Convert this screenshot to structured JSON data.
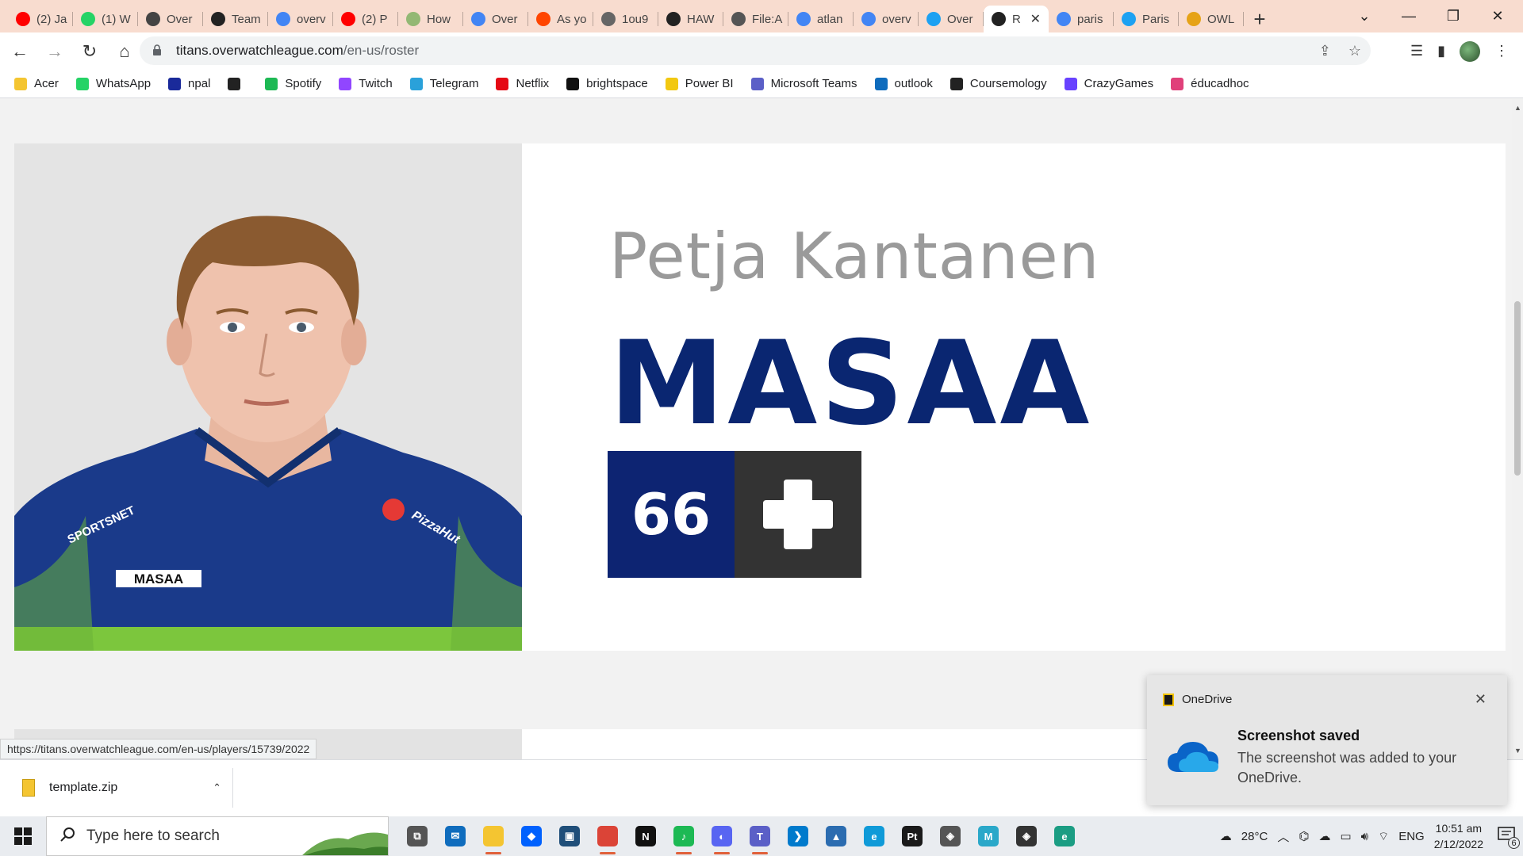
{
  "browser": {
    "tabs": [
      {
        "title": "(2) Ja",
        "favicon": "youtube-icon",
        "color": "#ff0000"
      },
      {
        "title": "(1) W",
        "favicon": "whatsapp-icon",
        "color": "#25d366"
      },
      {
        "title": "Over",
        "favicon": "overwatch-icon",
        "color": "#444444"
      },
      {
        "title": "Team",
        "favicon": "owl-icon",
        "color": "#222222"
      },
      {
        "title": "overv",
        "favicon": "google-icon",
        "color": "#4285f4"
      },
      {
        "title": "(2) P",
        "favicon": "youtube-icon",
        "color": "#ff0000"
      },
      {
        "title": "How",
        "favicon": "wikihow-icon",
        "color": "#93b874"
      },
      {
        "title": "Over",
        "favicon": "google-icon",
        "color": "#4285f4"
      },
      {
        "title": "As yo",
        "favicon": "reddit-icon",
        "color": "#ff4500"
      },
      {
        "title": "1ou9",
        "favicon": "globe-icon",
        "color": "#666666"
      },
      {
        "title": "HAW",
        "favicon": "owl-icon",
        "color": "#222222"
      },
      {
        "title": "File:A",
        "favicon": "wiki-icon",
        "color": "#555555"
      },
      {
        "title": "atlan",
        "favicon": "google-icon",
        "color": "#4285f4"
      },
      {
        "title": "overv",
        "favicon": "google-icon",
        "color": "#4285f4"
      },
      {
        "title": "Over",
        "favicon": "twitter-icon",
        "color": "#1da1f2"
      },
      {
        "title": "R",
        "favicon": "owl-icon",
        "color": "#222222",
        "active": true
      },
      {
        "title": "paris",
        "favicon": "google-icon",
        "color": "#4285f4"
      },
      {
        "title": "Paris",
        "favicon": "twitter-icon",
        "color": "#1da1f2"
      },
      {
        "title": "OWL",
        "favicon": "owl-coin-icon",
        "color": "#e6a317"
      }
    ],
    "url_host": "titans.overwatchleague.com",
    "url_path": "/en-us/roster",
    "bookmarks": [
      {
        "label": "Acer",
        "icon": "folder-icon",
        "color": "#f4c531"
      },
      {
        "label": "WhatsApp",
        "icon": "whatsapp-icon",
        "color": "#25d366"
      },
      {
        "label": "npal",
        "icon": "npal-icon",
        "color": "#1a2a9a"
      },
      {
        "label": "",
        "icon": "globe-icon",
        "color": "#222222"
      },
      {
        "label": "Spotify",
        "icon": "spotify-icon",
        "color": "#1db954"
      },
      {
        "label": "Twitch",
        "icon": "twitch-icon",
        "color": "#9146ff"
      },
      {
        "label": "Telegram",
        "icon": "telegram-icon",
        "color": "#2aa1da"
      },
      {
        "label": "Netflix",
        "icon": "netflix-icon",
        "color": "#e50914"
      },
      {
        "label": "brightspace",
        "icon": "np-icon",
        "color": "#111111"
      },
      {
        "label": "Power BI",
        "icon": "powerbi-icon",
        "color": "#f2c811"
      },
      {
        "label": "Microsoft Teams",
        "icon": "teams-icon",
        "color": "#5b5fc7"
      },
      {
        "label": "outlook",
        "icon": "outlook-icon",
        "color": "#0f6cbd"
      },
      {
        "label": "Coursemology",
        "icon": "coursemology-icon",
        "color": "#222222"
      },
      {
        "label": "CrazyGames",
        "icon": "crazygames-icon",
        "color": "#6842ff"
      },
      {
        "label": "éducadhoc",
        "icon": "educadhoc-icon",
        "color": "#e0407a"
      }
    ]
  },
  "player": {
    "full_name": "Petja Kantanen",
    "handle": "MASAA",
    "number": "66",
    "role_icon": "support-plus-icon",
    "jersey_text": "MASAA",
    "jersey_sponsor_left": "SPORTSNET",
    "jersey_sponsor_right": "PizzaHut",
    "team_color": "#0a2671"
  },
  "status_url": "https://titans.overwatchleague.com/en-us/players/15739/2022",
  "download": {
    "filename": "template.zip"
  },
  "toast": {
    "app": "OneDrive",
    "title": "Screenshot saved",
    "body": "The screenshot was added to your OneDrive."
  },
  "taskbar": {
    "search_placeholder": "Type here to search",
    "apps": [
      {
        "name": "task-view-icon",
        "label": "⧉",
        "color": "#555555",
        "running": false
      },
      {
        "name": "mail-icon",
        "label": "✉",
        "color": "#0f6cbd",
        "running": false
      },
      {
        "name": "file-explorer-icon",
        "label": "",
        "color": "#f4c531",
        "running": true
      },
      {
        "name": "dropbox-icon",
        "label": "◆",
        "color": "#0061fe",
        "running": false
      },
      {
        "name": "store-icon",
        "label": "▣",
        "color": "#1f4e79",
        "running": false
      },
      {
        "name": "chrome-icon",
        "label": "",
        "color": "#db4437",
        "running": true
      },
      {
        "name": "netflix-icon",
        "label": "N",
        "color": "#111111",
        "running": false
      },
      {
        "name": "spotify-icon",
        "label": "♪",
        "color": "#1db954",
        "running": true
      },
      {
        "name": "discord-icon",
        "label": "◐",
        "color": "#5865f2",
        "running": true
      },
      {
        "name": "teams-icon",
        "label": "T",
        "color": "#5b5fc7",
        "running": true
      },
      {
        "name": "vscode-icon",
        "label": "❯",
        "color": "#007acc",
        "running": false
      },
      {
        "name": "photos-icon",
        "label": "▲",
        "color": "#2b6cb0",
        "running": false
      },
      {
        "name": "edge-icon",
        "label": "e",
        "color": "#0f9ad8",
        "running": false
      },
      {
        "name": "pycharm-icon",
        "label": "Pt",
        "color": "#1a1a1a",
        "running": false
      },
      {
        "name": "unity-icon",
        "label": "◈",
        "color": "#555555",
        "running": false
      },
      {
        "name": "maya-icon",
        "label": "M",
        "color": "#2aa8c9",
        "running": false
      },
      {
        "name": "unity-hub-icon",
        "label": "◈",
        "color": "#333333",
        "running": false
      },
      {
        "name": "edge-dev-icon",
        "label": "e",
        "color": "#1b9d83",
        "running": false
      }
    ],
    "weather": "28°C",
    "language": "ENG",
    "time": "10:51 am",
    "date": "2/12/2022",
    "notifications": "6"
  }
}
